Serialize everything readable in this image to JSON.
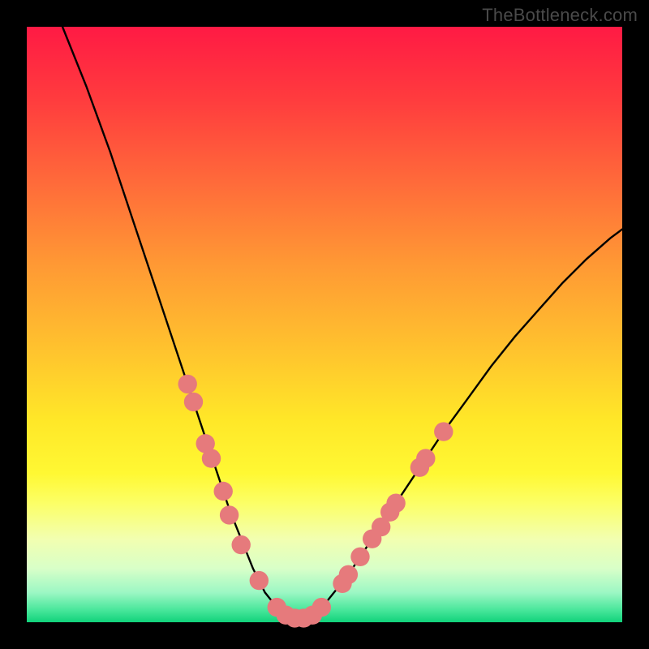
{
  "watermark": {
    "text": "TheBottleneck.com"
  },
  "chart_data": {
    "type": "line",
    "title": "",
    "xlabel": "",
    "ylabel": "",
    "xlim": [
      0,
      100
    ],
    "ylim": [
      0,
      100
    ],
    "grid": false,
    "legend": false,
    "background": "rainbow-gradient",
    "series": [
      {
        "name": "bottleneck-curve",
        "color": "#000000",
        "x": [
          6,
          10,
          14,
          18,
          22,
          26,
          28,
          30,
          32,
          34,
          36,
          38,
          40,
          42,
          44,
          46,
          48,
          50,
          54,
          58,
          62,
          66,
          70,
          74,
          78,
          82,
          86,
          90,
          94,
          98,
          100
        ],
        "y": [
          100,
          90,
          79,
          67,
          55,
          43,
          37,
          31,
          25,
          19,
          14,
          9,
          5,
          2.5,
          1,
          0.5,
          1,
          3,
          8,
          14,
          20,
          26,
          32,
          37.5,
          43,
          48,
          52.5,
          57,
          61,
          64.5,
          66
        ]
      }
    ],
    "markers": [
      {
        "name": "pink-dots",
        "color": "#e67a7c",
        "radius": 1.6,
        "points": [
          {
            "x": 27,
            "y": 40
          },
          {
            "x": 28,
            "y": 37
          },
          {
            "x": 30,
            "y": 30
          },
          {
            "x": 31,
            "y": 27.5
          },
          {
            "x": 33,
            "y": 22
          },
          {
            "x": 34,
            "y": 18
          },
          {
            "x": 36,
            "y": 13
          },
          {
            "x": 39,
            "y": 7
          },
          {
            "x": 42,
            "y": 2.5
          },
          {
            "x": 43.5,
            "y": 1.2
          },
          {
            "x": 45,
            "y": 0.7
          },
          {
            "x": 46.5,
            "y": 0.7
          },
          {
            "x": 48,
            "y": 1.2
          },
          {
            "x": 49.5,
            "y": 2.5
          },
          {
            "x": 53,
            "y": 6.5
          },
          {
            "x": 54,
            "y": 8
          },
          {
            "x": 56,
            "y": 11
          },
          {
            "x": 58,
            "y": 14
          },
          {
            "x": 59.5,
            "y": 16
          },
          {
            "x": 61,
            "y": 18.5
          },
          {
            "x": 62,
            "y": 20
          },
          {
            "x": 66,
            "y": 26
          },
          {
            "x": 67,
            "y": 27.5
          },
          {
            "x": 70,
            "y": 32
          }
        ]
      }
    ]
  }
}
